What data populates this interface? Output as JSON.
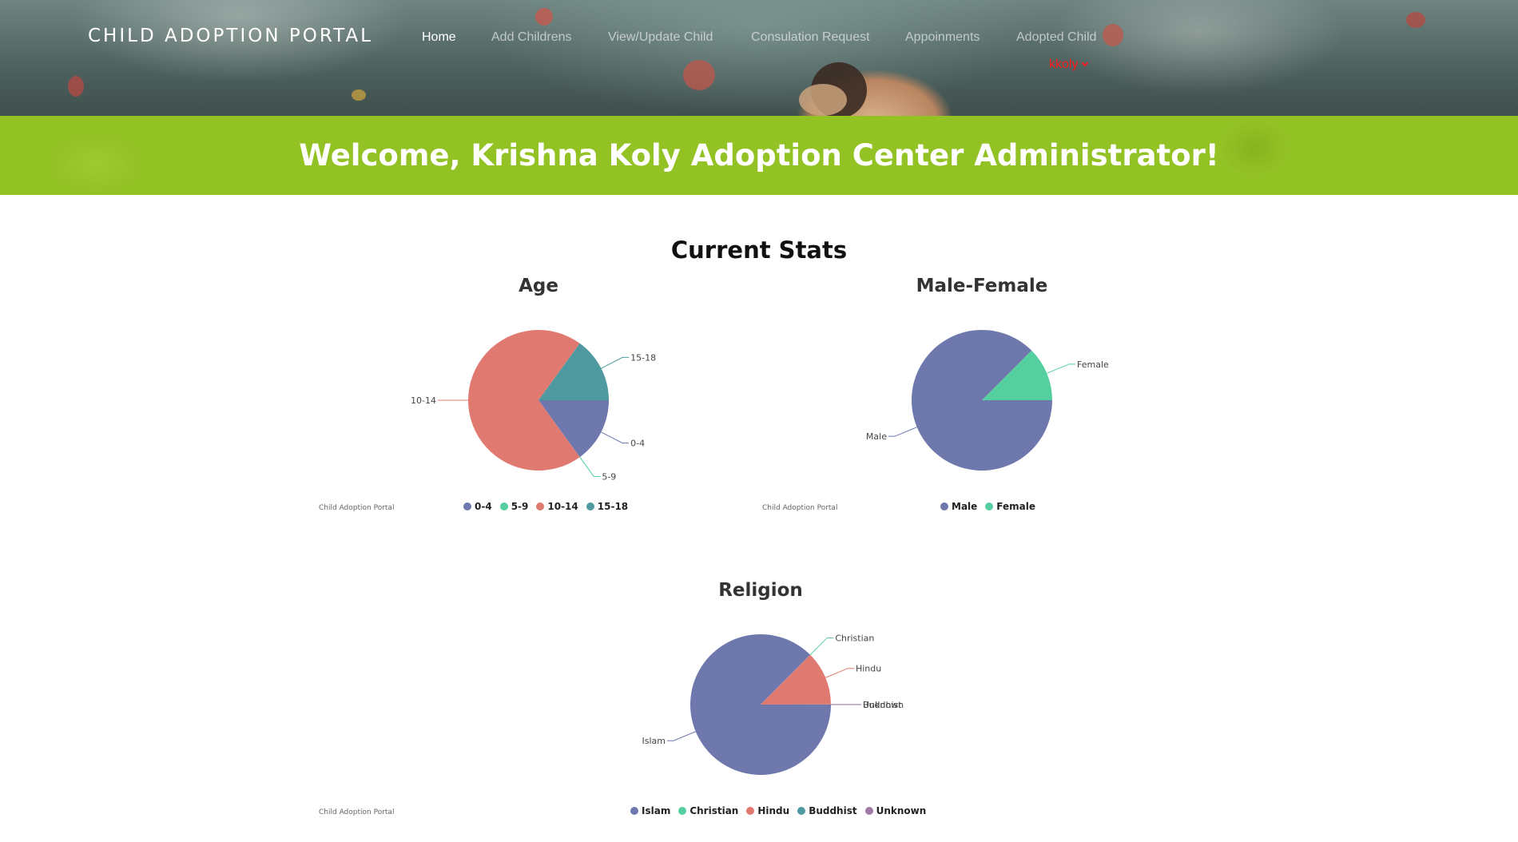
{
  "header": {
    "brand": "CHILD ADOPTION PORTAL",
    "nav": [
      {
        "label": "Home",
        "active": true
      },
      {
        "label": "Add Childrens",
        "active": false
      },
      {
        "label": "View/Update Child",
        "active": false
      },
      {
        "label": "Consulation Request",
        "active": false
      },
      {
        "label": "Appoinments",
        "active": false
      },
      {
        "label": "Adopted Child",
        "active": false
      }
    ],
    "user": "kkoly"
  },
  "welcome": {
    "text": "Welcome, Krishna Koly Adoption Center Administrator!"
  },
  "stats": {
    "title": "Current Stats",
    "credit": "Child Adoption Portal"
  },
  "colors": {
    "purple": "#6e78ad",
    "teal": "#55cfa0",
    "salmon": "#e07a70",
    "darkteal": "#4e9aa0",
    "mauve": "#a17aa3",
    "accent_green": "#93c225",
    "user_red": "#ff1a1a"
  },
  "chart_data": [
    {
      "type": "pie",
      "title": "Age",
      "labels": [
        "0-4",
        "5-9",
        "10-14",
        "15-18"
      ],
      "values": [
        15,
        0.01,
        70,
        15
      ],
      "colors": [
        "#6e78ad",
        "#55cfa0",
        "#e07a70",
        "#4e9aa0"
      ],
      "legend": "bottom"
    },
    {
      "type": "pie",
      "title": "Male-Female",
      "labels": [
        "Male",
        "Female"
      ],
      "values": [
        87.5,
        12.5
      ],
      "colors": [
        "#6e78ad",
        "#55cfa0"
      ],
      "legend": "bottom"
    },
    {
      "type": "pie",
      "title": "Religion",
      "labels": [
        "Islam",
        "Christian",
        "Hindu",
        "Buddhist",
        "Unknown"
      ],
      "values": [
        87.5,
        0.01,
        12.5,
        0.01,
        0.01
      ],
      "colors": [
        "#6e78ad",
        "#55cfa0",
        "#e07a70",
        "#4e9aa0",
        "#a17aa3"
      ],
      "legend": "bottom"
    }
  ]
}
